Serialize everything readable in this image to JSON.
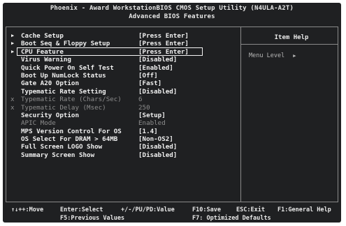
{
  "header": {
    "line1": "Phoenix - Award WorkstationBIOS CMOS Setup Utility (N4ULA-A2T)",
    "line2": "Advanced BIOS Features"
  },
  "items": [
    {
      "arrow": "▶",
      "label": "Cache Setup",
      "value": "[Press Enter]",
      "dim": false,
      "selected": false
    },
    {
      "arrow": "▶",
      "label": "Boot Seq & Floppy Setup",
      "value": "[Press Enter]",
      "dim": false,
      "selected": false
    },
    {
      "arrow": "▶",
      "label": "CPU Feature",
      "value": "[Press Enter]",
      "dim": false,
      "selected": true
    },
    {
      "arrow": "",
      "label": "Virus Warning",
      "value": "[Disabled]",
      "dim": false,
      "selected": false
    },
    {
      "arrow": "",
      "label": "Quick Power On Self Test",
      "value": "[Enabled]",
      "dim": false,
      "selected": false
    },
    {
      "arrow": "",
      "label": "Boot Up NumLock Status",
      "value": "[Off]",
      "dim": false,
      "selected": false
    },
    {
      "arrow": "",
      "label": "Gate A20 Option",
      "value": "[Fast]",
      "dim": false,
      "selected": false
    },
    {
      "arrow": "",
      "label": "Typematic Rate Setting",
      "value": "[Disabled]",
      "dim": false,
      "selected": false
    },
    {
      "arrow": "x",
      "label": "Typematic Rate (Chars/Sec)",
      "value": "6",
      "dim": true,
      "selected": false
    },
    {
      "arrow": "x",
      "label": "Typematic Delay (Msec)",
      "value": "250",
      "dim": true,
      "selected": false
    },
    {
      "arrow": "",
      "label": "Security Option",
      "value": "[Setup]",
      "dim": false,
      "selected": false
    },
    {
      "arrow": "",
      "label": "APIC Mode",
      "value": "Enabled",
      "dim": true,
      "selected": false
    },
    {
      "arrow": "",
      "label": "MPS Version Control For OS",
      "value": "[1.4]",
      "dim": false,
      "selected": false
    },
    {
      "arrow": "",
      "label": "OS Select For DRAM > 64MB",
      "value": "[Non-OS2]",
      "dim": false,
      "selected": false
    },
    {
      "arrow": "",
      "label": "Full Screen LOGO Show",
      "value": "[Disabled]",
      "dim": false,
      "selected": false
    },
    {
      "arrow": "",
      "label": "Summary Screen Show",
      "value": "[Disabled]",
      "dim": false,
      "selected": false
    }
  ],
  "help": {
    "title": "Item Help",
    "line": "Menu Level",
    "arrow": "▶"
  },
  "footer": {
    "move": "↑↓++:Move",
    "select": "Enter:Select",
    "values": "+/-/PU/PD:Value",
    "save": "F10:Save",
    "exit": "ESC:Exit",
    "general_help": "F1:General Help",
    "prev": "F5:Previous Values",
    "defaults": "F7: Optimized Defaults"
  }
}
